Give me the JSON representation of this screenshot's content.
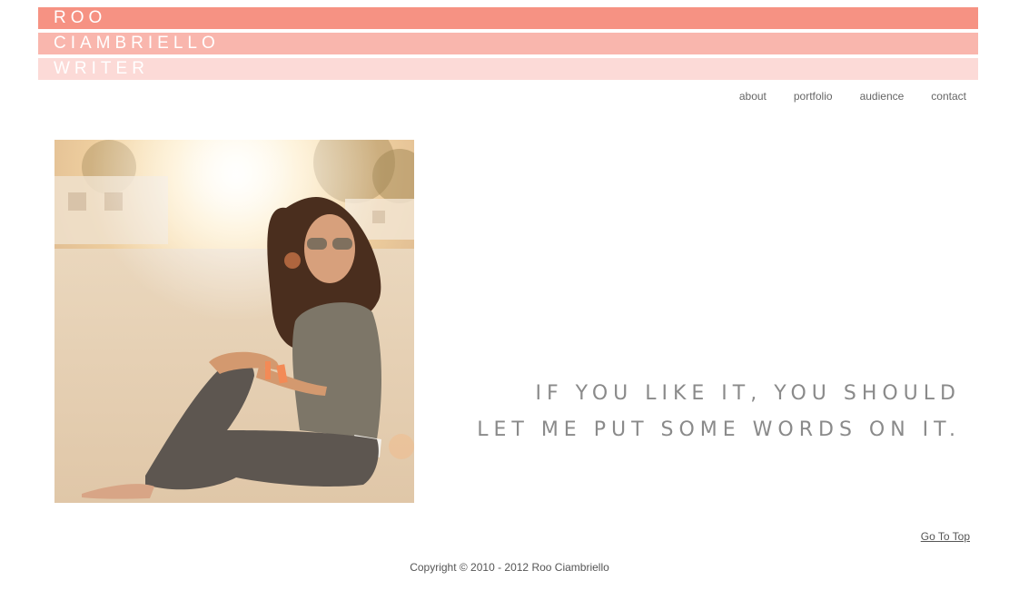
{
  "header": {
    "line1": "ROO",
    "line2": "CIAMBRIELLO",
    "line3": "WRITER"
  },
  "nav": {
    "items": [
      "about",
      "portfolio",
      "audience",
      "contact"
    ]
  },
  "main": {
    "tagline_line1": "IF YOU LIKE IT, YOU SHOULD",
    "tagline_line2": "LET ME PUT SOME WORDS ON IT.",
    "photo_subject": "woman-sitting-on-beach"
  },
  "footer": {
    "go_to_top": "Go To Top",
    "copyright": "Copyright © 2010 - 2012 Roo Ciambriello"
  },
  "colors": {
    "bar1": "#f69283",
    "bar2": "#f9b6ad",
    "bar3": "#fcdad7",
    "text_gray": "#8a8a8a"
  }
}
